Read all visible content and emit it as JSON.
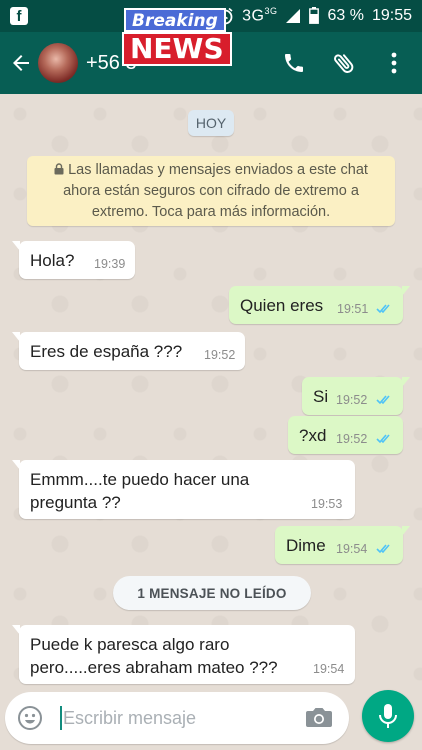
{
  "status_bar": {
    "network": "3G",
    "network_sup": "3G",
    "battery": "63 %",
    "time": "19:55"
  },
  "overlay": {
    "breaking": "Breaking",
    "news": "NEWS"
  },
  "header": {
    "contact_name": "+56          3"
  },
  "chat": {
    "date": "HOY",
    "encryption_notice": "Las llamadas y mensajes enviados a este chat ahora están seguros con cifrado de extremo a extremo. Toca para más información.",
    "unread_label": "1 MENSAJE NO LEÍDO",
    "messages": [
      {
        "direction": "in",
        "text": "Hola?",
        "time": "19:39"
      },
      {
        "direction": "out",
        "text": "Quien eres",
        "time": "19:51",
        "status": "read"
      },
      {
        "direction": "in",
        "text": "Eres de españa ???",
        "time": "19:52"
      },
      {
        "direction": "out",
        "text": "Si",
        "time": "19:52",
        "status": "read"
      },
      {
        "direction": "out",
        "text": "?xd",
        "time": "19:52",
        "status": "read"
      },
      {
        "direction": "in",
        "text_line1": "Emmm....te puedo hacer una",
        "text_line2": "pregunta ??",
        "time": "19:53"
      },
      {
        "direction": "out",
        "text": "Dime",
        "time": "19:54",
        "status": "read"
      },
      {
        "direction": "in",
        "text_line1": "Puede k paresca algo raro",
        "text_line2": "pero.....eres abraham mateo ???",
        "time": "19:54"
      }
    ]
  },
  "composer": {
    "placeholder": "Escribir mensaje"
  },
  "colors": {
    "toolbar": "#075e54",
    "status_bar": "#054d44",
    "outgoing_bubble": "#dcf8c6",
    "incoming_bubble": "#ffffff",
    "read_ticks": "#4fc3f7",
    "mic_button": "#00a884"
  }
}
